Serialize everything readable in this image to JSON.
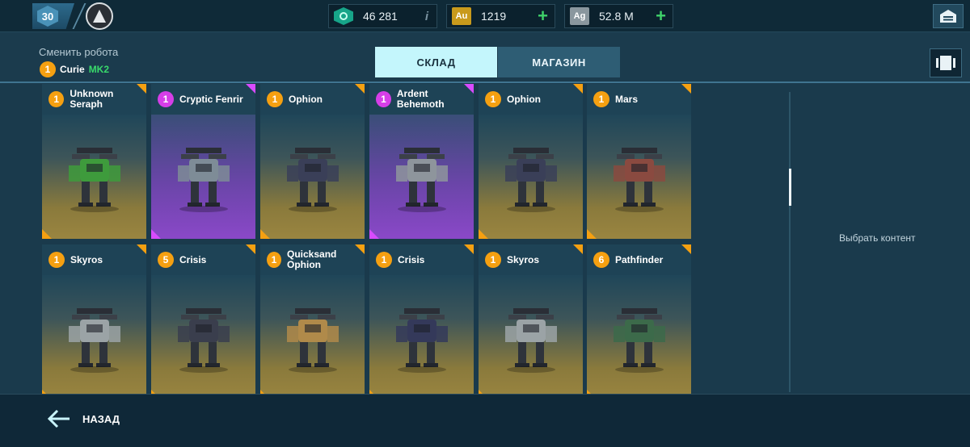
{
  "player": {
    "level": "30"
  },
  "resources": {
    "keys": "46 281",
    "gold": {
      "icon_text": "Au",
      "value": "1219"
    },
    "silver": {
      "icon_text": "Ag",
      "value": "52.8 M"
    },
    "info_label": "i",
    "plus_label": "+"
  },
  "header": {
    "change_robot_label": "Сменить робота",
    "current_robot": {
      "level": "1",
      "name": "Curie",
      "mark": "MK2"
    }
  },
  "tabs": [
    {
      "label": "СКЛАД",
      "active": true
    },
    {
      "label": "МАГАЗИН",
      "active": false
    }
  ],
  "robots": [
    {
      "level": "1",
      "name": "Unknown Seraph",
      "rarity": "gold",
      "color": "#3e9b3c"
    },
    {
      "level": "1",
      "name": "Cryptic Fenrir",
      "rarity": "purple",
      "color": "#7e8c97"
    },
    {
      "level": "1",
      "name": "Ophion",
      "rarity": "gold",
      "color": "#3a3f58"
    },
    {
      "level": "1",
      "name": "Ardent Behemoth",
      "rarity": "purple",
      "color": "#8e959c"
    },
    {
      "level": "1",
      "name": "Ophion",
      "rarity": "gold",
      "color": "#3a3f58"
    },
    {
      "level": "1",
      "name": "Mars",
      "rarity": "gold",
      "color": "#8a4a40"
    },
    {
      "level": "1",
      "name": "Skyros",
      "rarity": "gold",
      "color": "#9ba3a6"
    },
    {
      "level": "5",
      "name": "Crisis",
      "rarity": "gold",
      "color": "#3a3e4d"
    },
    {
      "level": "1",
      "name": "Quicksand Ophion",
      "rarity": "gold",
      "color": "#b08a4a"
    },
    {
      "level": "1",
      "name": "Crisis",
      "rarity": "gold",
      "color": "#34395a"
    },
    {
      "level": "1",
      "name": "Skyros",
      "rarity": "gold",
      "color": "#9ba3a6"
    },
    {
      "level": "6",
      "name": "Pathfinder",
      "rarity": "gold",
      "color": "#3c6a4a"
    }
  ],
  "right_panel": {
    "label": "Выбрать контент"
  },
  "footer": {
    "back_label": "НАЗАД"
  },
  "colors": {
    "accent": "#c4f6fc",
    "gold": "#f5a011",
    "epic": "#d63ee8",
    "green": "#39d96b"
  }
}
